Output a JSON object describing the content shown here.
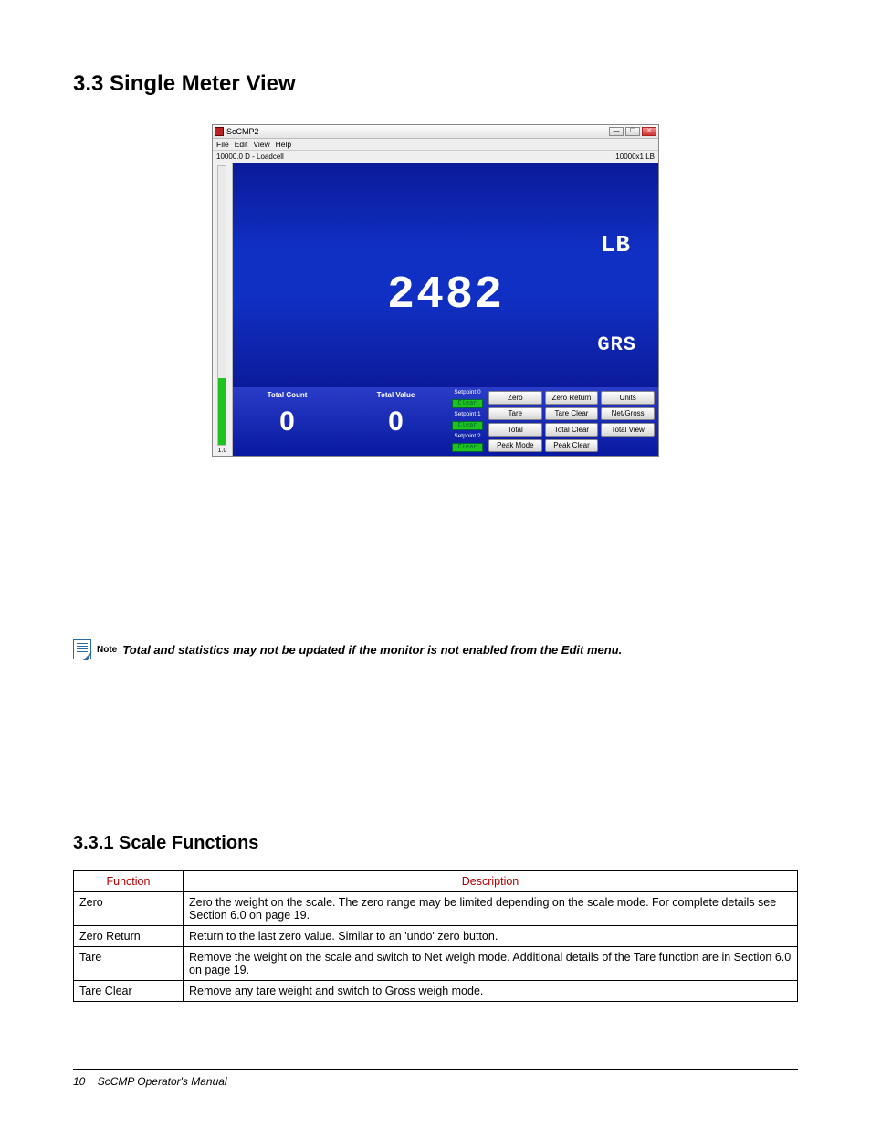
{
  "heading": "3.3  Single Meter View",
  "window": {
    "title": "ScCMP2",
    "menus": [
      "File",
      "Edit",
      "View",
      "Help"
    ],
    "tab_left": "10000.0 D - Loadcell",
    "tab_right": "10000x1 LB",
    "gauge_label": "1.0",
    "display": {
      "value": "2482",
      "unit": "LB",
      "mode": "GRS"
    },
    "totals": [
      {
        "header": "Total Count",
        "value": "0"
      },
      {
        "header": "Total Value",
        "value": "0"
      }
    ],
    "setpoints": [
      {
        "label": "Setpoint 0",
        "btn": "Clear"
      },
      {
        "label": "Setpoint 1",
        "btn": "Clear"
      },
      {
        "label": "Setpoint 2",
        "btn": "Clear"
      }
    ],
    "buttons": [
      "Zero",
      "Zero Return",
      "Units",
      "Tare",
      "Tare Clear",
      "Net/Gross",
      "Total",
      "Total Clear",
      "Total View",
      "Peak Mode",
      "Peak Clear",
      ""
    ]
  },
  "note": {
    "label": "Note",
    "text": "Total and statistics may not be updated if the monitor is not enabled from the Edit menu."
  },
  "subheading": "3.3.1   Scale Functions",
  "table": {
    "headers": [
      "Function",
      "Description"
    ],
    "rows": [
      {
        "f": "Zero",
        "d": "Zero the weight on the scale. The zero range may be limited depending on the scale mode. For complete details see Section 6.0 on page 19."
      },
      {
        "f": "Zero Return",
        "d": "Return to the last zero value.  Similar to an 'undo' zero button."
      },
      {
        "f": "Tare",
        "d": "Remove the weight on the scale and switch to Net weigh mode.  Additional details of the Tare function are in Section 6.0 on page 19."
      },
      {
        "f": "Tare Clear",
        "d": "Remove any tare weight and switch to Gross weigh mode."
      }
    ]
  },
  "footer": {
    "page": "10",
    "title": "ScCMP Operator's Manual"
  }
}
